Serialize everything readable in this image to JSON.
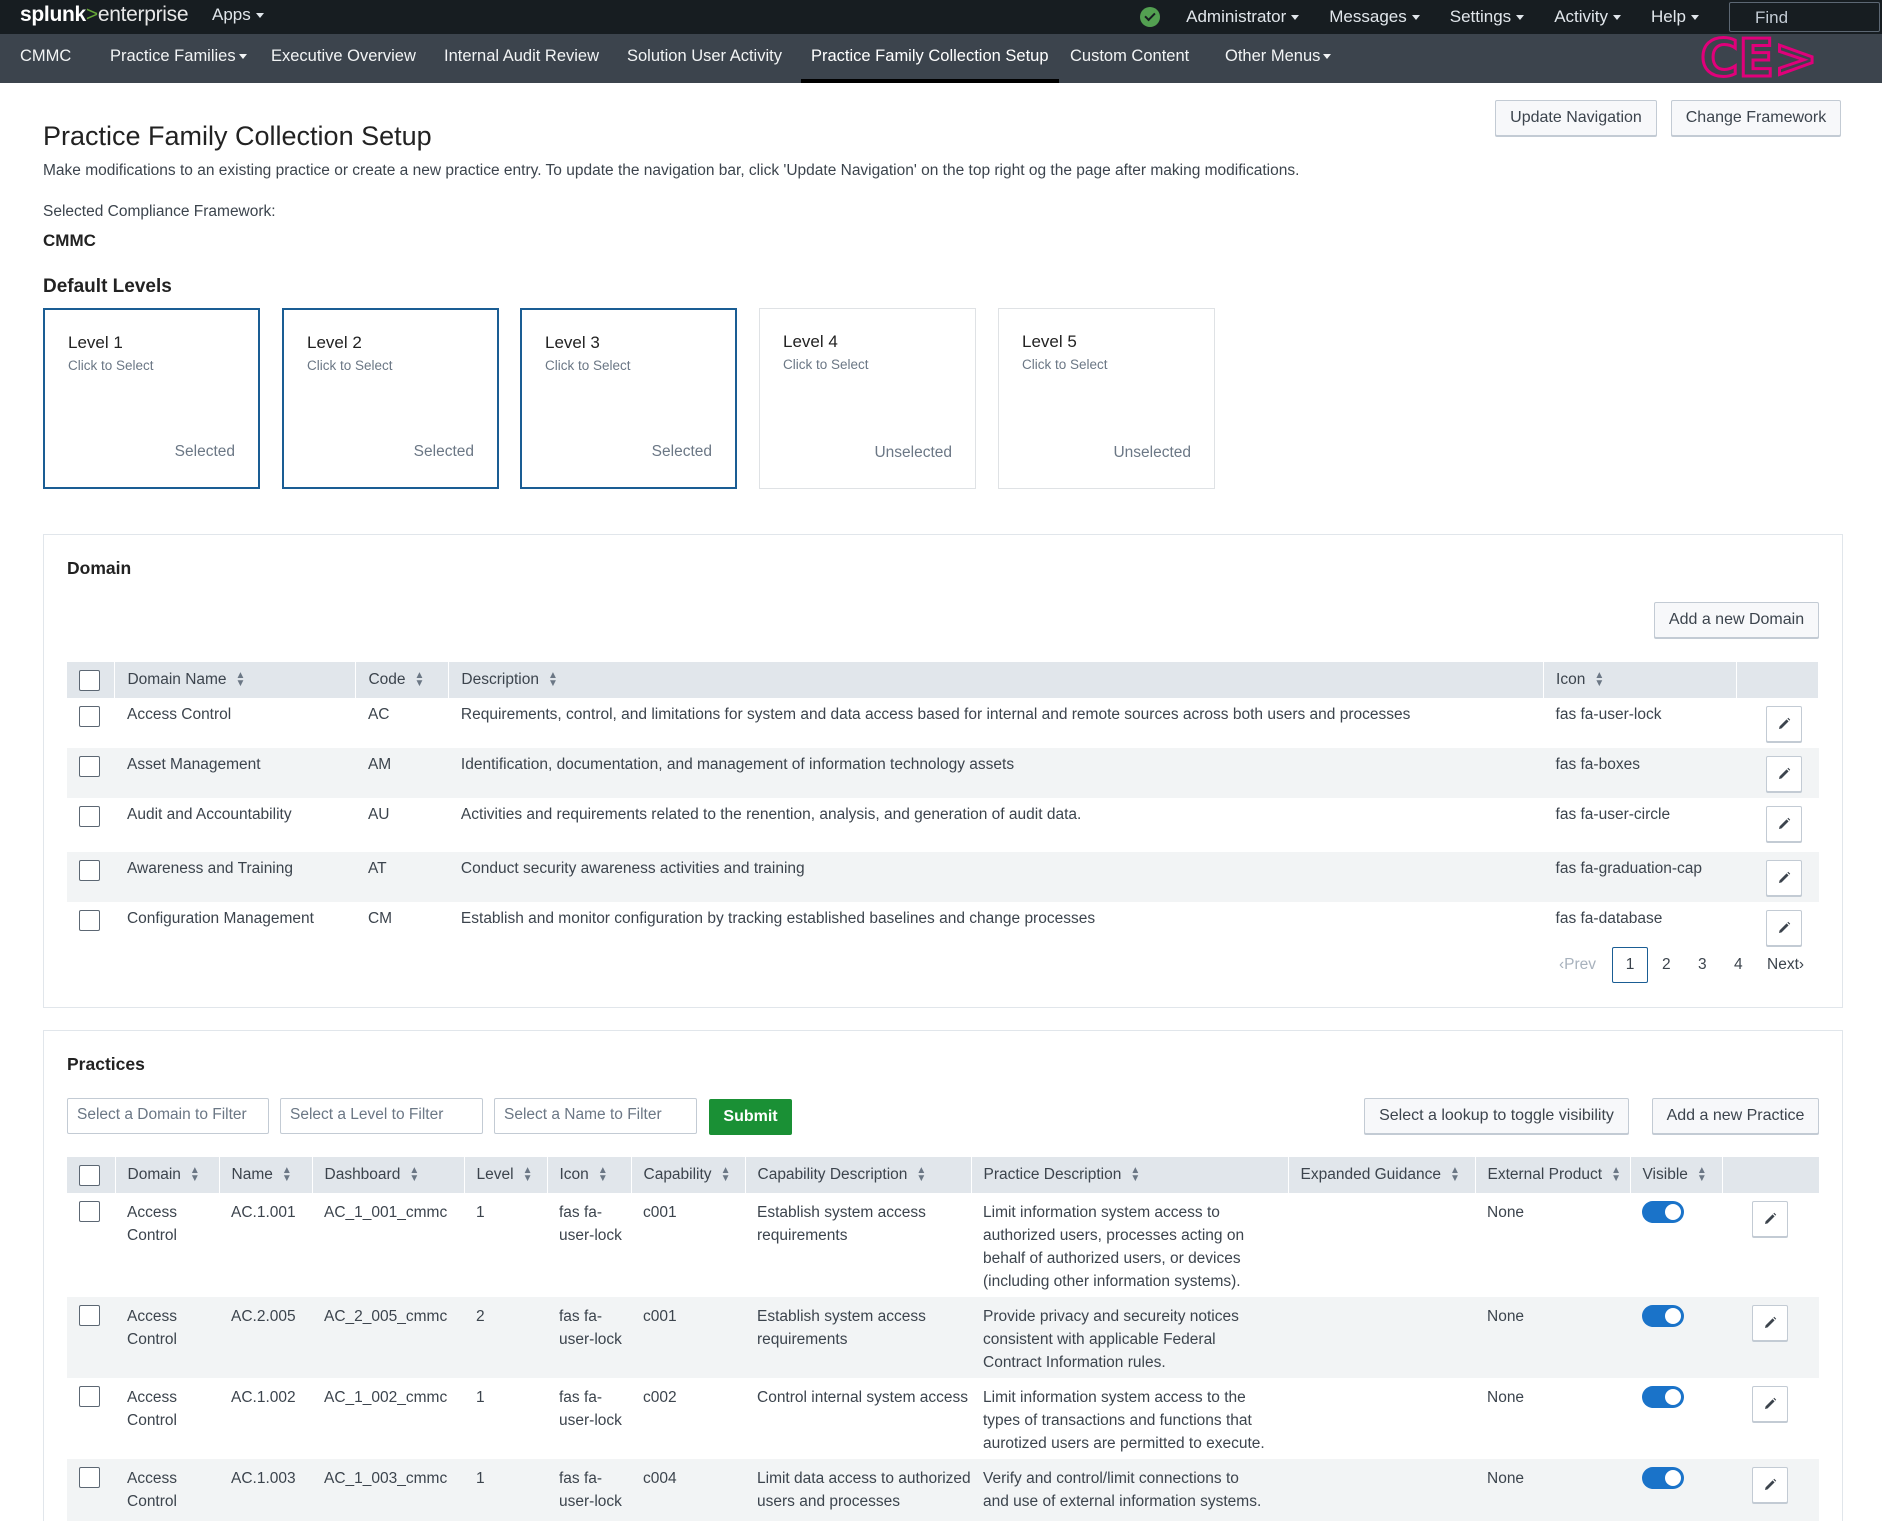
{
  "topbar": {
    "logo_main": "splunk",
    "logo_gt": ">",
    "logo_suffix": "enterprise",
    "apps": "Apps",
    "menus": [
      "Administrator",
      "Messages",
      "Settings",
      "Activity",
      "Help"
    ],
    "find": "Find",
    "status_color": "#53a051"
  },
  "appnav": {
    "items": [
      "CMMC",
      "Practice Families",
      "Executive Overview",
      "Internal Audit Review",
      "Solution User Activity",
      "Practice Family Collection Setup",
      "Custom Content",
      "Other Menus"
    ],
    "active": "Practice Family Collection Setup",
    "logo_text": "CE>",
    "logo_color": "#e0007a"
  },
  "header": {
    "title": "Practice Family Collection Setup",
    "description": "Make modifications to an existing practice or create a new practice entry. To update the navigation bar, click 'Update Navigation' on the top right og the page after making modifications.",
    "update_nav": "Update Navigation",
    "change_framework": "Change Framework",
    "framework_label": "Selected Compliance Framework:",
    "framework_value": "CMMC"
  },
  "levels": {
    "title": "Default Levels",
    "items": [
      {
        "name": "Level 1",
        "sub": "Click to Select",
        "state": "Selected"
      },
      {
        "name": "Level 2",
        "sub": "Click to Select",
        "state": "Selected"
      },
      {
        "name": "Level 3",
        "sub": "Click to Select",
        "state": "Selected"
      },
      {
        "name": "Level 4",
        "sub": "Click to Select",
        "state": "Unselected"
      },
      {
        "name": "Level 5",
        "sub": "Click to Select",
        "state": "Unselected"
      }
    ]
  },
  "domain": {
    "title": "Domain",
    "add_button": "Add a new Domain",
    "columns": [
      "Domain Name",
      "Code",
      "Description",
      "Icon"
    ],
    "rows": [
      {
        "name": "Access Control",
        "code": "AC",
        "description": "Requirements, control, and limitations for system and data access based for internal and remote sources across both users and processes",
        "icon": "fas fa-user-lock"
      },
      {
        "name": "Asset Management",
        "code": "AM",
        "description": "Identification, documentation, and management of information technology assets",
        "icon": "fas fa-boxes"
      },
      {
        "name": "Audit and Accountability",
        "code": "AU",
        "description": "Activities and requirements related to the renention, analysis, and generation of audit data.",
        "icon": "fas fa-user-circle"
      },
      {
        "name": "Awareness and Training",
        "code": "AT",
        "description": "Conduct security awareness activities and training",
        "icon": "fas fa-graduation-cap"
      },
      {
        "name": "Configuration Management",
        "code": "CM",
        "description": "Establish and monitor configuration by tracking established baselines and change processes",
        "icon": "fas fa-database"
      }
    ],
    "pager": {
      "prev": "Prev",
      "pages": [
        "1",
        "2",
        "3",
        "4"
      ],
      "current": "1",
      "next": "Next"
    }
  },
  "practices": {
    "title": "Practices",
    "filter_domain": "Select a Domain to Filter",
    "filter_level": "Select a Level to Filter",
    "filter_name": "Select a Name to Filter",
    "submit": "Submit",
    "toggle_lookup": "Select a lookup to toggle visibility",
    "add_button": "Add a new Practice",
    "columns": [
      "Domain",
      "Name",
      "Dashboard",
      "Level",
      "Icon",
      "Capability",
      "Capability Description",
      "Practice Description",
      "Expanded Guidance",
      "External Product",
      "Visible"
    ],
    "rows": [
      {
        "domain": "Access Control",
        "name": "AC.1.001",
        "dashboard": "AC_1_001_cmmc",
        "level": "1",
        "icon": "fas fa-user-lock",
        "capability": "c001",
        "cap_desc": "Establish system access requirements",
        "practice_desc": "Limit information system access to authorized users, processes acting on behalf of authorized users, or devices (including other information systems).",
        "guidance": "",
        "external": "None"
      },
      {
        "domain": "Access Control",
        "name": "AC.2.005",
        "dashboard": "AC_2_005_cmmc",
        "level": "2",
        "icon": "fas fa-user-lock",
        "capability": "c001",
        "cap_desc": "Establish system access requirements",
        "practice_desc": "Provide privacy and secureity notices consistent with applicable Federal Contract Information rules.",
        "guidance": "",
        "external": "None"
      },
      {
        "domain": "Access Control",
        "name": "AC.1.002",
        "dashboard": "AC_1_002_cmmc",
        "level": "1",
        "icon": "fas fa-user-lock",
        "capability": "c002",
        "cap_desc": "Control internal system access",
        "practice_desc": "Limit information system access to the types of transactions and functions that aurotized users are permitted to execute.",
        "guidance": "",
        "external": "None"
      },
      {
        "domain": "Access Control",
        "name": "AC.1.003",
        "dashboard": "AC_1_003_cmmc",
        "level": "1",
        "icon": "fas fa-user-lock",
        "capability": "c004",
        "cap_desc": "Limit data access to authorized users and processes",
        "practice_desc": "Verify and control/limit connections to and use of external information systems.",
        "guidance": "",
        "external": "None"
      }
    ]
  }
}
